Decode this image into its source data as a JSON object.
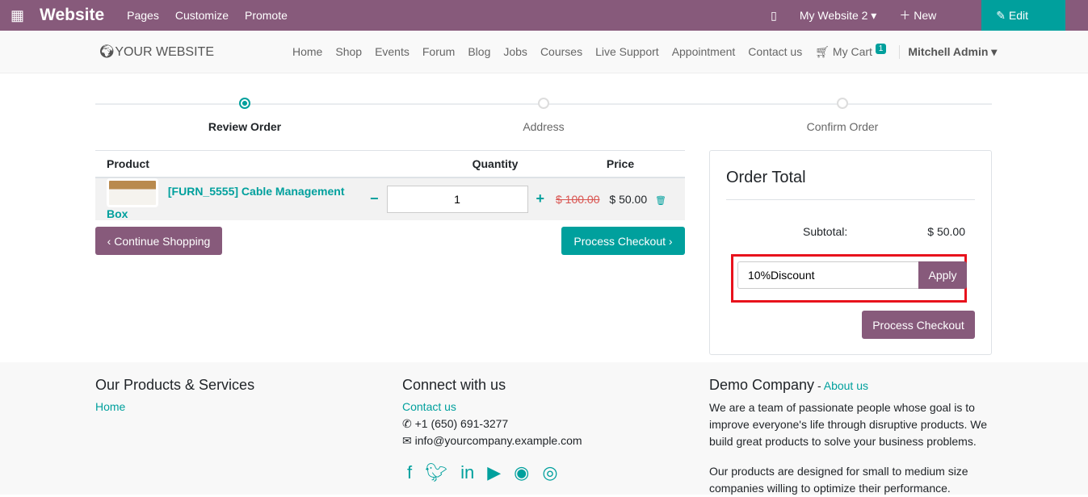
{
  "topbar": {
    "app": "Website",
    "menus": [
      "Pages",
      "Customize",
      "Promote"
    ],
    "website": "My Website 2 ▾",
    "new": "New",
    "edit": "Edit"
  },
  "nav": {
    "logo": "YOUR WEBSITE",
    "links": [
      "Home",
      "Shop",
      "Events",
      "Forum",
      "Blog",
      "Jobs",
      "Courses",
      "Live Support",
      "Appointment",
      "Contact us"
    ],
    "cart": "My Cart",
    "cart_count": "1",
    "user": "Mitchell Admin ▾"
  },
  "steps": [
    "Review Order",
    "Address",
    "Confirm Order"
  ],
  "cart": {
    "headers": {
      "product": "Product",
      "quantity": "Quantity",
      "price": "Price"
    },
    "item": {
      "name": "[FURN_5555] Cable Management Box",
      "qty": "1",
      "old_price": "$ 100.00",
      "price": "$ 50.00"
    }
  },
  "buttons": {
    "continue": "Continue Shopping",
    "checkout": "Process Checkout"
  },
  "order": {
    "title": "Order Total",
    "subtotal_label": "Subtotal:",
    "subtotal": "$ 50.00",
    "coupon": "10%Discount",
    "apply": "Apply",
    "checkout": "Process Checkout"
  },
  "footer": {
    "col1": {
      "title": "Our Products & Services",
      "link": "Home"
    },
    "col2": {
      "title": "Connect with us",
      "link": "Contact us",
      "phone": "+1 (650) 691-3277",
      "email": "info@yourcompany.example.com"
    },
    "col3": {
      "title": "Demo Company",
      "sep": " - ",
      "link": "About us",
      "p1": "We are a team of passionate people whose goal is to improve everyone's life through disruptive products. We build great products to solve your business problems.",
      "p2": "Our products are designed for small to medium size companies willing to optimize their performance."
    }
  },
  "colors": {
    "brand": "#875a7b",
    "accent": "#00a09d",
    "highlight": "#e8121c"
  }
}
